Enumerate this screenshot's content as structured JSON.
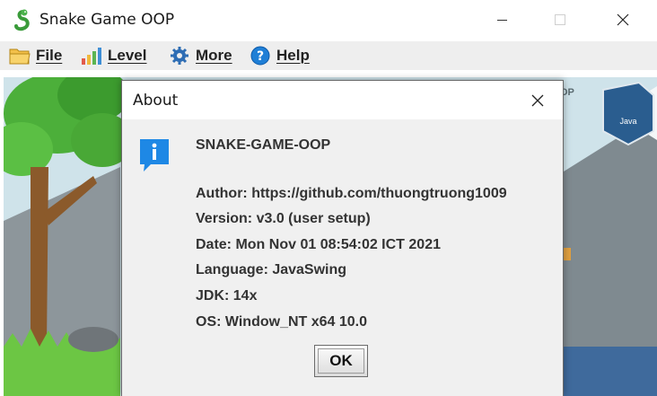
{
  "window": {
    "title": "Snake Game OOP",
    "icon": "snake-icon"
  },
  "menu": {
    "items": [
      {
        "label": "File",
        "icon": "folder-icon"
      },
      {
        "label": "Level",
        "icon": "bar-chart-icon"
      },
      {
        "label": "More",
        "icon": "gear-icon"
      },
      {
        "label": "Help",
        "icon": "question-icon"
      }
    ]
  },
  "background": {
    "partial_text": "OP",
    "badge_text": "Java"
  },
  "dialog": {
    "title": "About",
    "icon": "info-icon",
    "app_name": "SNAKE-GAME-OOP",
    "author": "Author: https://github.com/thuongtruong1009",
    "version": "Version: v3.0 (user setup)",
    "date": "Date: Mon Nov 01 08:54:02 ICT 2021",
    "language": "Language: JavaSwing",
    "jdk": "JDK: 14x",
    "os": "OS: Window_NT x64 10.0",
    "ok_label": "OK"
  },
  "colors": {
    "info_blue": "#1e88e5",
    "menu_bar": "#eeeeee",
    "dialog_bg": "#f0f0f0",
    "grass": "#6cc644",
    "tree_trunk": "#8b5a2b"
  }
}
